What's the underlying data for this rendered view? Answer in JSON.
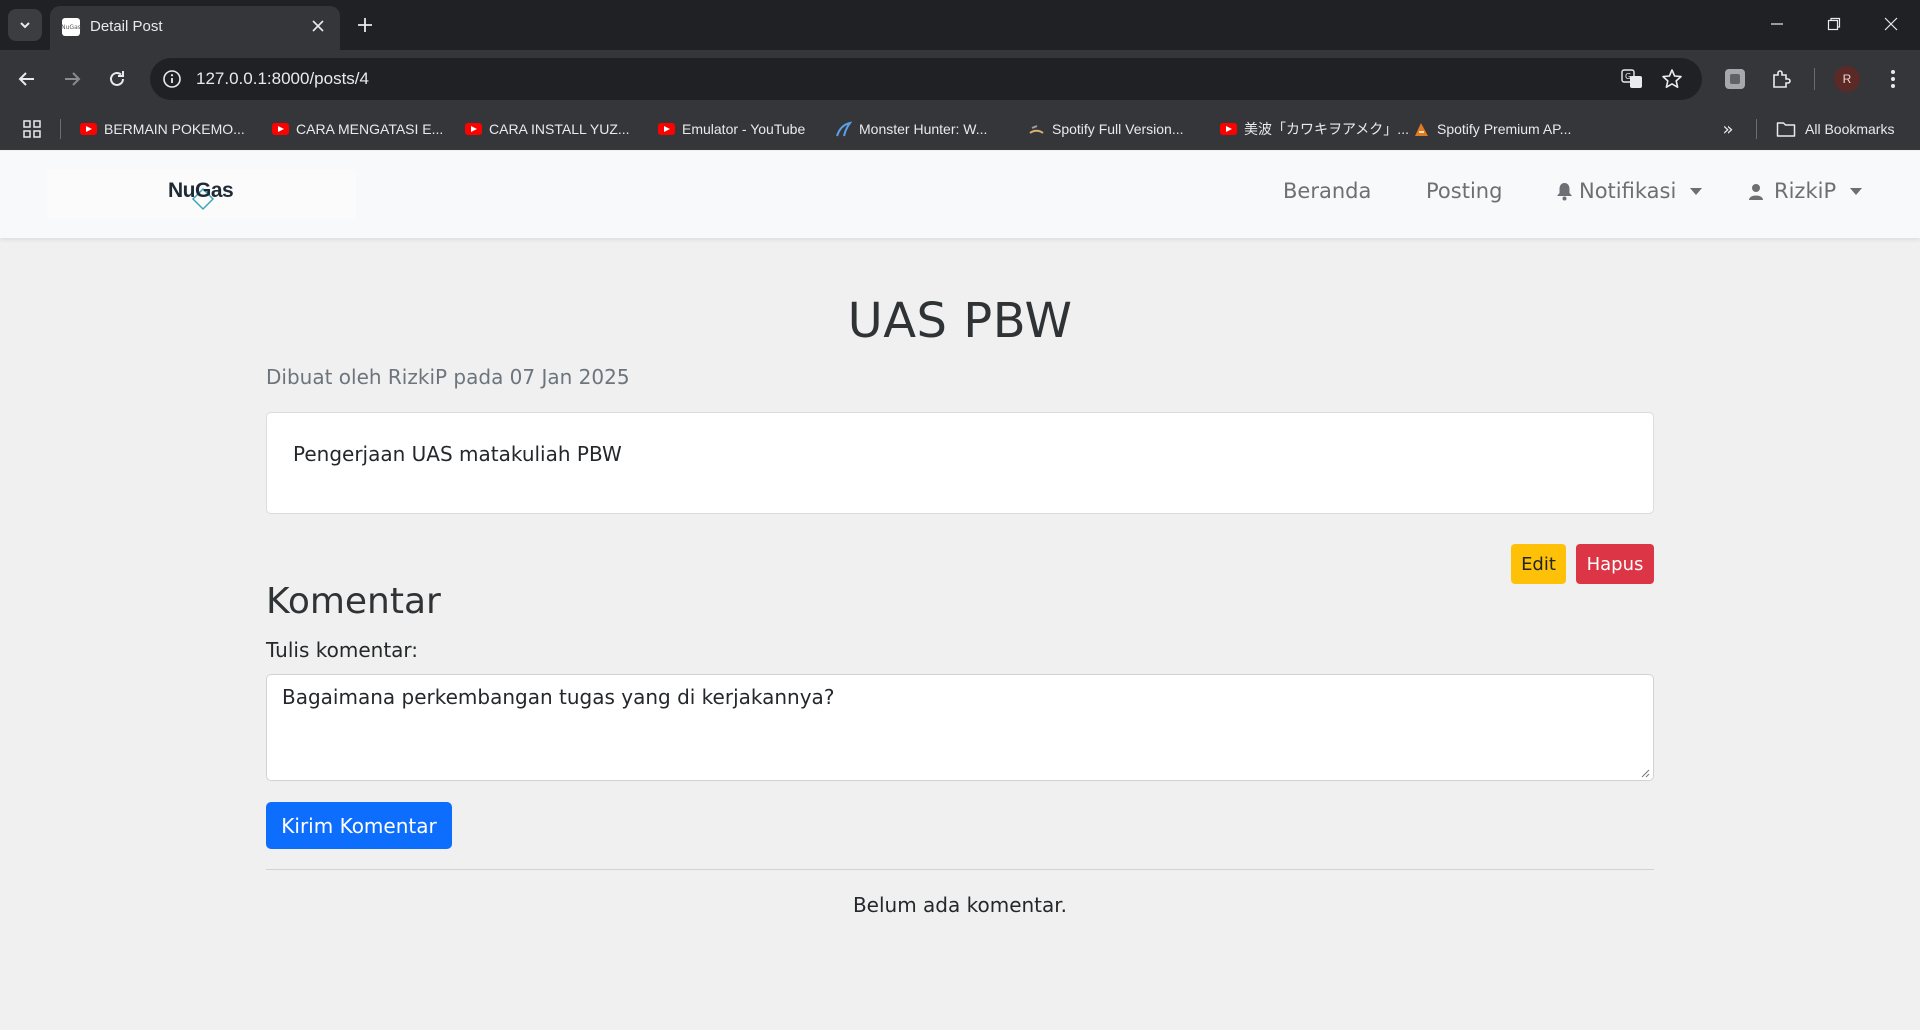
{
  "browser": {
    "tab_title": "Detail Post",
    "favicon_text": "NuGas",
    "url": "127.0.0.1:8000/posts/4",
    "profile_initial": "R",
    "bookmarks": [
      {
        "label": "BERMAIN POKEMO...",
        "icon": "youtube-icon"
      },
      {
        "label": "CARA MENGATASI E...",
        "icon": "youtube-icon"
      },
      {
        "label": "CARA INSTALL YUZ...",
        "icon": "youtube-icon"
      },
      {
        "label": "Emulator - YouTube",
        "icon": "youtube-icon"
      },
      {
        "label": "Monster Hunter: W...",
        "icon": "site-icon"
      },
      {
        "label": "Spotify Full Version...",
        "icon": "site-icon"
      },
      {
        "label": "美波「カワキヲアメク」...",
        "icon": "youtube-icon"
      },
      {
        "label": "Spotify Premium AP...",
        "icon": "site-icon"
      }
    ],
    "all_bookmarks_label": "All Bookmarks"
  },
  "navbar": {
    "logo_text": "NuGas",
    "links": {
      "home": "Beranda",
      "posting": "Posting",
      "notifications": "Notifikasi",
      "user": "RizkiP"
    }
  },
  "post": {
    "title": "UAS PBW",
    "meta": "Dibuat oleh RizkiP pada 07 Jan 2025",
    "body": "Pengerjaan UAS matakuliah PBW",
    "edit_label": "Edit",
    "delete_label": "Hapus"
  },
  "comments": {
    "heading": "Komentar",
    "input_label": "Tulis komentar:",
    "input_value": "Bagaimana perkembangan tugas yang di kerjakannya?",
    "submit_label": "Kirim Komentar",
    "empty_message": "Belum ada komentar."
  },
  "colors": {
    "edit_button": "#ffc107",
    "delete_button": "#dc3545",
    "submit_button": "#0d6efd"
  }
}
